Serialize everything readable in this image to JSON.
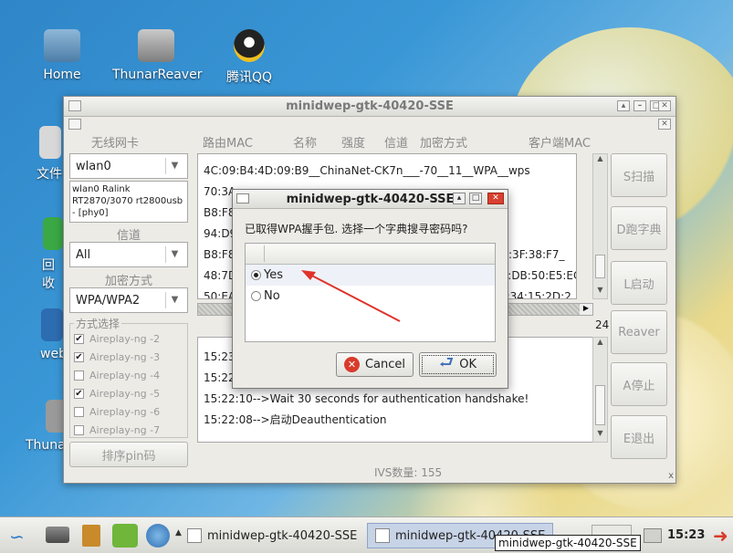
{
  "desktop": {
    "icons": [
      {
        "label": "Home"
      },
      {
        "label": "ThunarReaver"
      },
      {
        "label": "腾讯QQ"
      },
      {
        "label": "文件"
      },
      {
        "label": "回收"
      },
      {
        "label": "web"
      },
      {
        "label": "Thuna"
      }
    ]
  },
  "window": {
    "title": "minidwep-gtk-40420-SSE",
    "adapter_header": "无线网卡",
    "adapter_value": "wlan0",
    "adapter_desc": "wlan0 Ralink RT2870/3070 rt2800usb - [phy0]",
    "channel_label": "信道",
    "channel_value": "All",
    "encryption_label": "加密方式",
    "encryption_value": "WPA/WPA2",
    "method_label": "方式选择",
    "methods": [
      {
        "label": "Aireplay-ng -2",
        "checked": "✔"
      },
      {
        "label": "Aireplay-ng -3",
        "checked": "✔"
      },
      {
        "label": "Aireplay-ng -4",
        "checked": ""
      },
      {
        "label": "Aireplay-ng -5",
        "checked": "✔"
      },
      {
        "label": "Aireplay-ng -6",
        "checked": ""
      },
      {
        "label": "Aireplay-ng -7",
        "checked": ""
      }
    ],
    "pin_sort_button": "排序pin码",
    "columns": [
      "路由MAC",
      "名称",
      "强度",
      "信道",
      "加密方式",
      "客户端MAC"
    ],
    "networks": [
      "4C:09:B4:4D:09:B9__ChinaNet-CK7n___-70__11__WPA__wps",
      "70:3A:",
      "B8:F8",
      "94:D9",
      "B8:F8",
      "48:7D",
      "50:EA"
    ],
    "networks_right": [
      "",
      "",
      "",
      "",
      "2C:3F:38:F7_",
      "48:DB:50:E5:EC:2",
      "3F:34:15:2D:2"
    ],
    "side_count": "24",
    "log": [
      "15:23",
      "15:22",
      "15:22:10-->Wait 30 seconds for authentication handshake!",
      "15:22:08-->启动Deauthentication"
    ],
    "ivs_label": "IVS数量: 155",
    "buttons": {
      "scan": "S扫描",
      "dict": "D跑字典",
      "start": "L启动",
      "reaver": "Reaver",
      "stop": "A停止",
      "exit": "E退出"
    }
  },
  "dialog": {
    "title": "minidwep-gtk-40420-SSE",
    "prompt": "已取得WPA握手包. 选择一个字典搜寻密码吗?",
    "options": [
      {
        "label": "Yes",
        "selected": true
      },
      {
        "label": "No",
        "selected": false
      }
    ],
    "cancel": "Cancel",
    "ok": "OK"
  },
  "taskbar": {
    "task1": "minidwep-gtk-40420-SSE",
    "task2": "minidwep-gtk-40420-SSE",
    "clock": "15:23",
    "tooltip": "minidwep-gtk-40420-SSE"
  },
  "colors": {
    "arrow": "#e0332b",
    "dialog_close": "#d84030"
  }
}
